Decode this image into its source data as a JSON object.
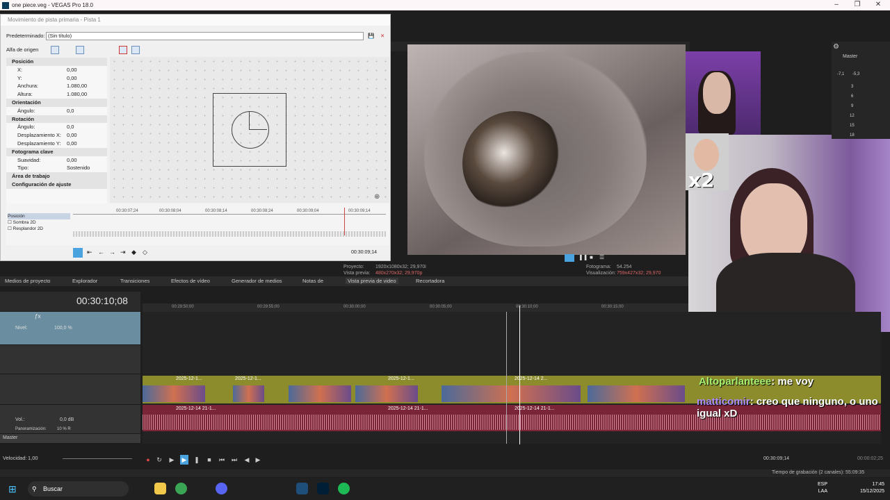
{
  "window": {
    "title": "one piece.veg - VEGAS Pro 18.0"
  },
  "track_motion": {
    "title": "Movimiento de pista primaria - Pista 1",
    "preset_label": "Predeterminado:",
    "preset_value": "(Sin título)",
    "source_alpha": "Alfa de origen",
    "groups": [
      {
        "name": "Posición",
        "props": [
          [
            "X:",
            "0,00"
          ],
          [
            "Y:",
            "0,00"
          ],
          [
            "Anchura:",
            "1.080,00"
          ],
          [
            "Altura:",
            "1.080,00"
          ]
        ]
      },
      {
        "name": "Orientación",
        "props": [
          [
            "Ángulo:",
            "0,0"
          ]
        ]
      },
      {
        "name": "Rotación",
        "props": [
          [
            "Ángulo:",
            "0,0"
          ],
          [
            "Desplazamiento X:",
            "0,00"
          ],
          [
            "Desplazamiento Y:",
            "0,00"
          ]
        ]
      },
      {
        "name": "Fotograma clave",
        "props": [
          [
            "Suavidad:",
            "0,00"
          ],
          [
            "Tipo:",
            "Sostenido"
          ]
        ]
      },
      {
        "name": "Área de trabajo",
        "props": []
      },
      {
        "name": "Configuración de ajuste",
        "props": []
      }
    ],
    "kf_rows": [
      "Posición",
      "Sombra 2D",
      "Resplandor 2D"
    ],
    "ruler": [
      "00:30:07;24",
      "00:30:08;04",
      "00:30:08;14",
      "00:30:08;24",
      "00:30:09;04",
      "00:30:09;14"
    ],
    "time": "00:30:09;14"
  },
  "preview": {
    "tab": "Vista previa de video",
    "project_label": "Proyecto:",
    "project_value": "1920x1080x32; 29,970i",
    "preview_label": "Vista previa:",
    "preview_value": "480x270x32; 29,970p",
    "frame_label": "Fotograma:",
    "frame_value": "54.254",
    "display_label": "Visualización:",
    "display_value": "759x427x32; 29,970"
  },
  "overlay": {
    "multiplier": "x2"
  },
  "master": {
    "label": "Master",
    "levels": [
      "-7,1",
      "-5,3",
      "3",
      "6",
      "9",
      "12",
      "15",
      "18"
    ]
  },
  "tabs": [
    "Medios de proyecto",
    "Explorador",
    "Transiciones",
    "Efectos de vídeo",
    "Generador de medios",
    "Notas de",
    "Vista previa de video",
    "Recortadora"
  ],
  "timeline": {
    "timecode": "00:30:10;08",
    "ruler": [
      "00:29:50;00",
      "00:29:55;00",
      "00:30:00;00",
      "00:30:05;00",
      "00:30:10;00",
      "00:30:15;00"
    ],
    "track1_level_label": "Nivel:",
    "track1_level": "100,0 %",
    "audio_vol_label": "Vol.:",
    "audio_vol": "0,0 dB",
    "audio_pan_label": "Panoramización:",
    "audio_pan": "10 % R",
    "master_label": "Master",
    "clip_label": "2025-12-1...",
    "clip_label_full": "2025-12-14 2...",
    "audio_clip_label": "2025-12-14 21-1..."
  },
  "chat": [
    {
      "user": "Altoparlanteee",
      "text": "me voy"
    },
    {
      "user": "matticomir",
      "text": "creo que ninguno, o uno igual xD"
    }
  ],
  "bottom": {
    "speed_label": "Velocidad:",
    "speed_value": "1,00",
    "cursor_time": "00:30:09;14",
    "record_time": "00:00:02;25",
    "status": "Tiempo de grabación (2 canales): 55:09:35"
  },
  "taskbar": {
    "search": "Buscar",
    "lang": "ESP",
    "region": "LAA",
    "time": "17:45",
    "date": "15/12/2025"
  },
  "colors": {
    "accent": "#4aa3df",
    "video_track": "#8c8c2d",
    "audio_track": "#7a2438",
    "chat_user": "#a6f070"
  }
}
